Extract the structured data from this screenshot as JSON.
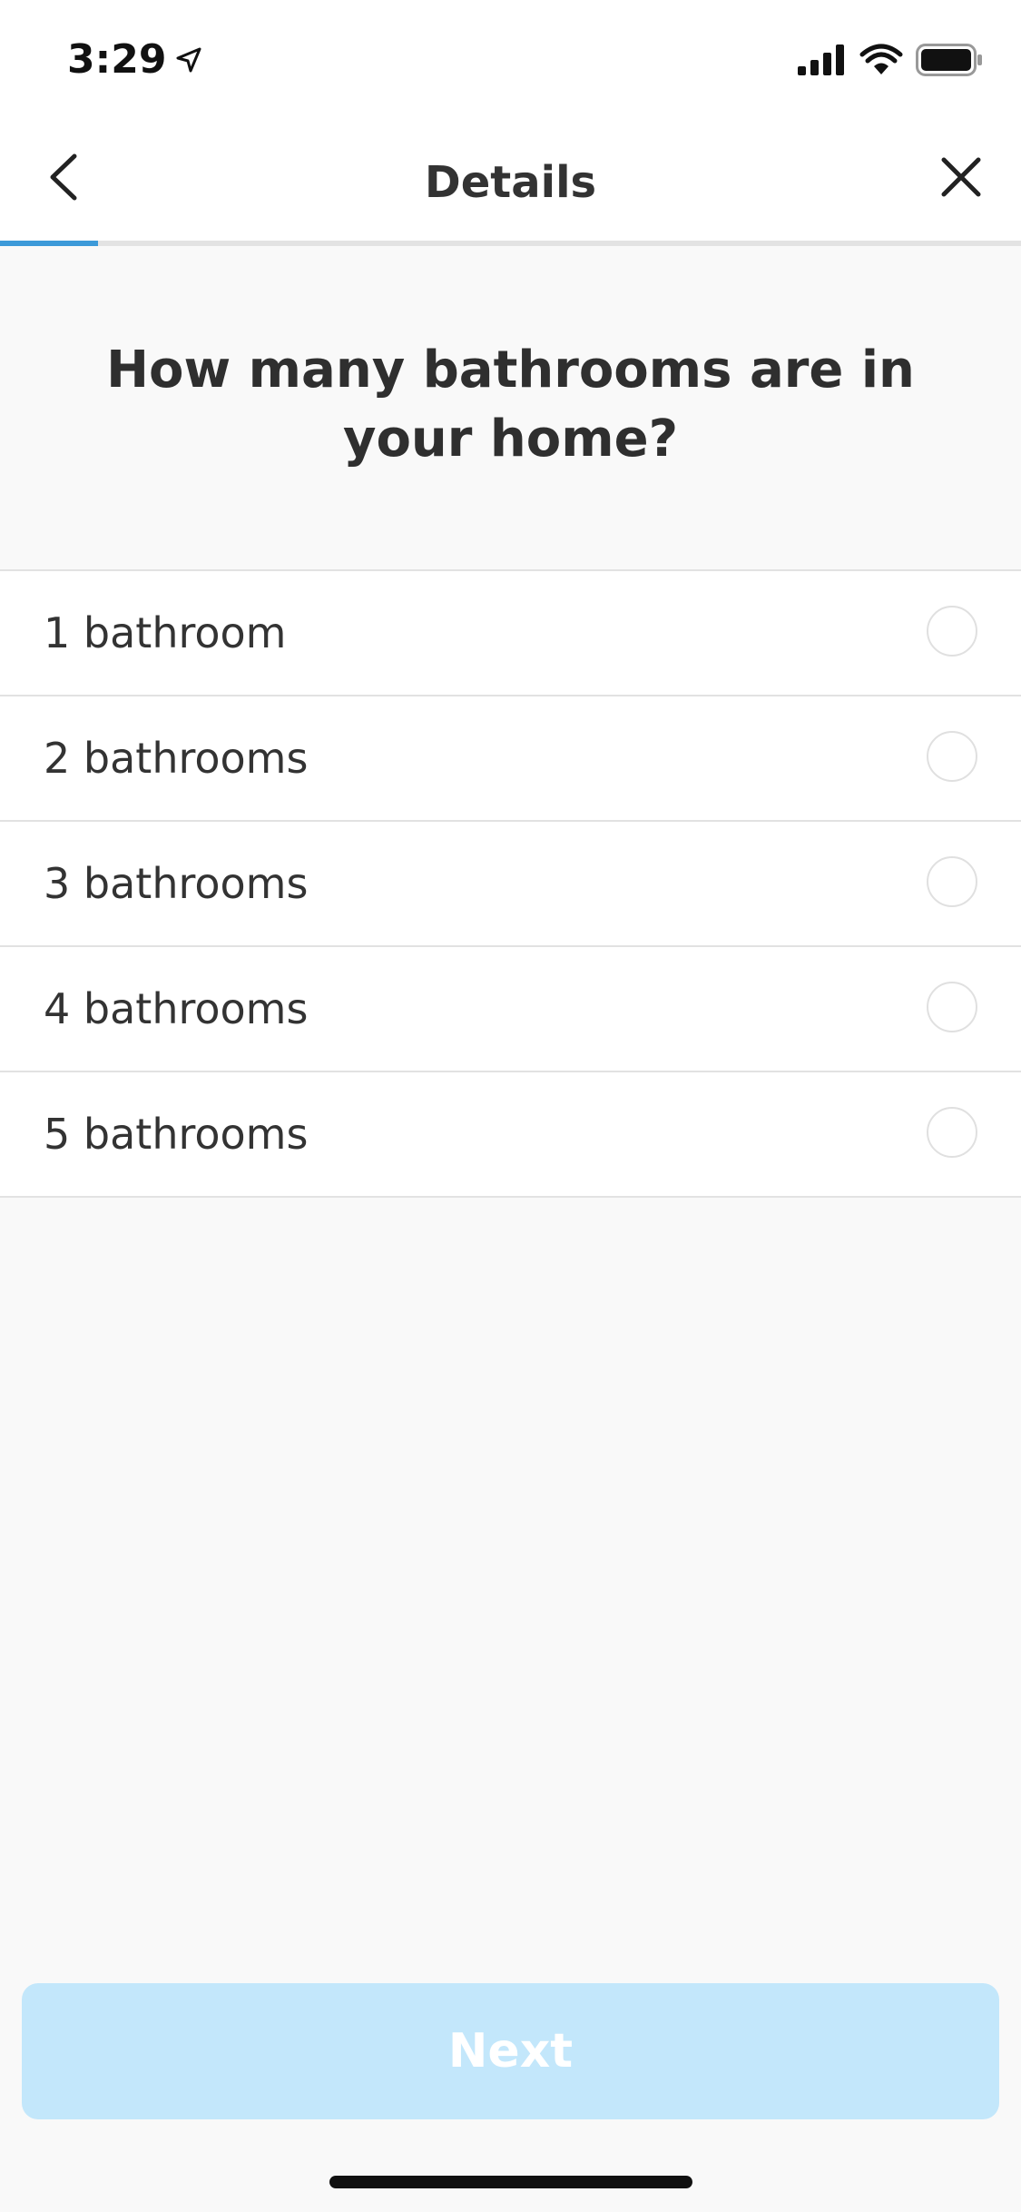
{
  "status_bar": {
    "time": "3:29",
    "icons": [
      "location-arrow-icon",
      "signal-icon",
      "wifi-icon",
      "battery-icon"
    ]
  },
  "nav": {
    "title": "Details",
    "back_icon": "chevron-left-icon",
    "close_icon": "close-icon",
    "progress": 0.096
  },
  "question": "How many bathrooms are in your home?",
  "options": [
    {
      "label": "1 bathroom",
      "selected": false
    },
    {
      "label": "2 bathrooms",
      "selected": false
    },
    {
      "label": "3 bathrooms",
      "selected": false
    },
    {
      "label": "4 bathrooms",
      "selected": false
    },
    {
      "label": "5 bathrooms",
      "selected": false
    }
  ],
  "next_button": {
    "label": "Next",
    "enabled": false
  },
  "colors": {
    "accent": "#3c9ad9",
    "button_disabled": "#c3e7fb",
    "background": "#f9f9f9"
  }
}
